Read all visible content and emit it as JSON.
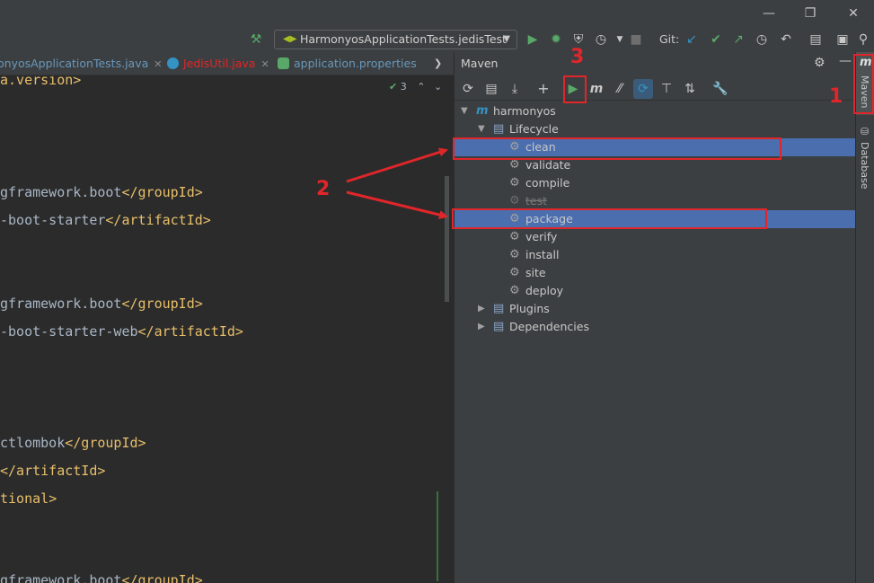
{
  "window": {
    "minimize_icon": "minimize-icon",
    "restore_icon": "restore-icon",
    "close_icon": "close-icon"
  },
  "toolbar": {
    "run_config": "HarmonyosApplicationTests.jedisTest",
    "git_label": "Git:"
  },
  "tabs": [
    {
      "label": "onyosApplicationTests.java",
      "color": "#6897bb"
    },
    {
      "label": "JedisUtil.java",
      "color": "#e0262a"
    },
    {
      "label": "application.properties",
      "color": "#6897bb"
    }
  ],
  "editor": {
    "inspection_count": "3",
    "lines": [
      {
        "tag_open": "",
        "text": "a.version",
        "tag_close": ">"
      },
      {
        "tag_open": "",
        "text": "gframework.boot",
        "tag_close": "</groupId>"
      },
      {
        "tag_open": "",
        "text": "-boot-starter",
        "tag_close": "</artifactId>"
      },
      {
        "tag_open": "",
        "text": "gframework.boot",
        "tag_close": "</groupId>"
      },
      {
        "tag_open": "",
        "text": "-boot-starter-web",
        "tag_close": "</artifactId>"
      },
      {
        "tag_open": "",
        "text": "ctlombok",
        "tag_close": "</groupId>"
      },
      {
        "tag_open": "",
        "text": "",
        "tag_close": "</artifactId>"
      },
      {
        "tag_open": "",
        "text": "tional",
        "tag_close": ">"
      },
      {
        "tag_open": "",
        "text": "gframework.boot",
        "tag_close": "</groupId>"
      }
    ]
  },
  "maven": {
    "title": "Maven",
    "tree": [
      {
        "label": "harmonyos",
        "level": 0,
        "expanded": true
      },
      {
        "label": "Lifecycle",
        "level": 1,
        "expanded": true
      },
      {
        "label": "clean",
        "level": 2,
        "selected": true
      },
      {
        "label": "validate",
        "level": 2
      },
      {
        "label": "compile",
        "level": 2
      },
      {
        "label": "test",
        "level": 2,
        "disabled": true
      },
      {
        "label": "package",
        "level": 2,
        "selected": true
      },
      {
        "label": "verify",
        "level": 2
      },
      {
        "label": "install",
        "level": 2
      },
      {
        "label": "site",
        "level": 2
      },
      {
        "label": "deploy",
        "level": 2
      },
      {
        "label": "Plugins",
        "level": 1,
        "expanded": false
      },
      {
        "label": "Dependencies",
        "level": 1,
        "expanded": false
      }
    ]
  },
  "side_stripe": {
    "maven_label": "Maven",
    "database_label": "Database"
  },
  "annotations": {
    "one": "1",
    "two": "2",
    "three": "3",
    "color": "#e0262a"
  },
  "colors": {
    "selection": "#4b6eaf",
    "run_green": "#59a869",
    "tag_yellow": "#e8bf6a"
  }
}
